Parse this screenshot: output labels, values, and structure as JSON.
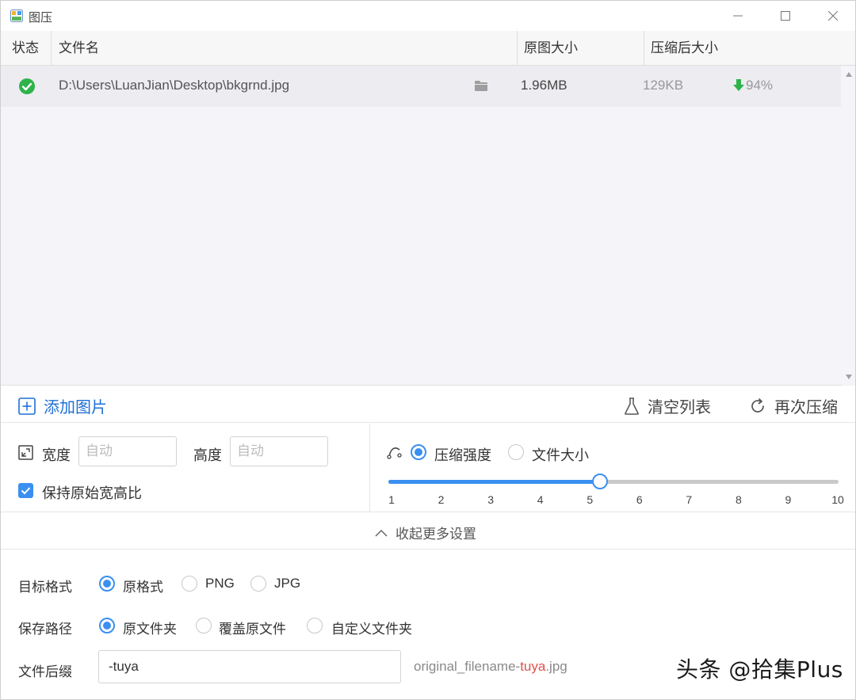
{
  "window": {
    "title": "图压",
    "icons": {
      "app": "app-logo-icon",
      "minimize": "minimize-icon",
      "maximize": "maximize-icon",
      "close": "close-icon"
    }
  },
  "table": {
    "headers": {
      "status": "状态",
      "filename": "文件名",
      "original_size": "原图大小",
      "compressed_size": "压缩后大小"
    },
    "rows": [
      {
        "status_icon": "check-circle-icon",
        "path": "D:\\Users\\LuanJian\\Desktop\\bkgrnd.jpg",
        "folder_icon": "folder-icon",
        "original_size": "1.96MB",
        "compressed_size": "129KB",
        "ratio": "94%",
        "ratio_icon": "arrow-down-icon"
      }
    ]
  },
  "toolbar": {
    "add_label": "添加图片",
    "clear_label": "清空列表",
    "recompress_label": "再次压缩"
  },
  "resize": {
    "width_label": "宽度",
    "width_placeholder": "自动",
    "height_label": "高度",
    "height_placeholder": "自动",
    "keep_ratio_label": "保持原始宽高比",
    "keep_ratio_checked": true
  },
  "compression": {
    "mode_strength_label": "压缩强度",
    "mode_size_label": "文件大小",
    "selected_mode": "strength",
    "slider_min": 1,
    "slider_max": 10,
    "slider_value": 5.2,
    "ticks": [
      "1",
      "2",
      "3",
      "4",
      "5",
      "6",
      "7",
      "8",
      "9",
      "10"
    ]
  },
  "collapse": {
    "label": "收起更多设置"
  },
  "output": {
    "format_label": "目标格式",
    "format_options": [
      "原格式",
      "PNG",
      "JPG"
    ],
    "format_selected": 0,
    "path_label": "保存路径",
    "path_options": [
      "原文件夹",
      "覆盖原文件",
      "自定义文件夹"
    ],
    "path_selected": 0,
    "suffix_label": "文件后缀",
    "suffix_value": "-tuya",
    "hint_prefix": "original_filename-",
    "hint_suffix": "tuya",
    "hint_ext": ".jpg"
  },
  "watermark": "头条 @拾集Plus",
  "colors": {
    "accent": "#3b8ff0",
    "link": "#1f6fd6",
    "success": "#2eb34a",
    "hint_accent": "#e0514b"
  }
}
